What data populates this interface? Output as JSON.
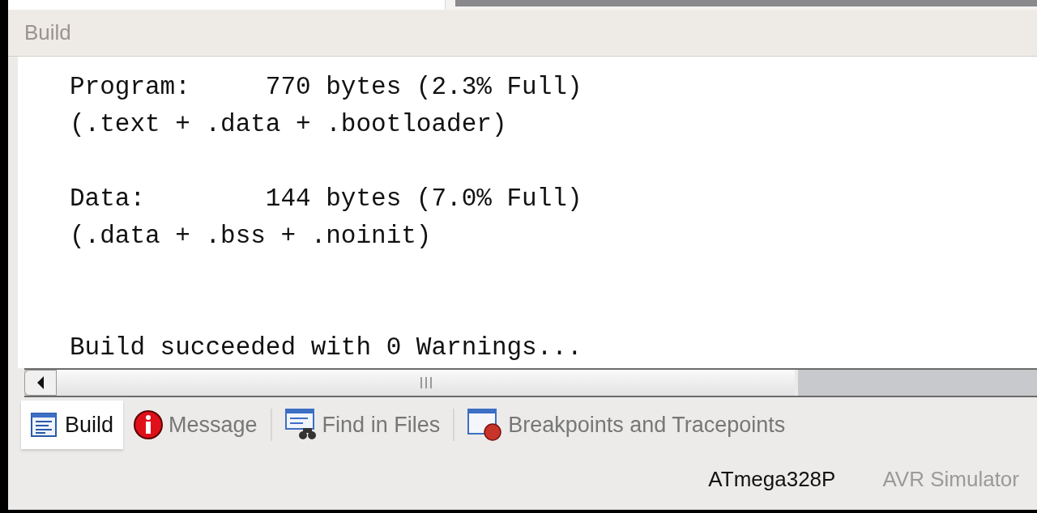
{
  "panel": {
    "title": "Build"
  },
  "output_text": "Program:     770 bytes (2.3% Full)\n(.text + .data + .bootloader)\n\nData:        144 bytes (7.0% Full)\n(.data + .bss + .noinit)\n\n\nBuild succeeded with 0 Warnings...",
  "tabs": [
    {
      "label": "Build",
      "kind": "build",
      "selected": true
    },
    {
      "label": "Message",
      "kind": "message",
      "selected": false
    },
    {
      "label": "Find in Files",
      "kind": "find",
      "selected": false
    },
    {
      "label": "Breakpoints and Tracepoints",
      "kind": "breakpoints",
      "selected": false
    }
  ],
  "status_bar": {
    "device": "ATmega328P",
    "tool": "AVR Simulator"
  }
}
